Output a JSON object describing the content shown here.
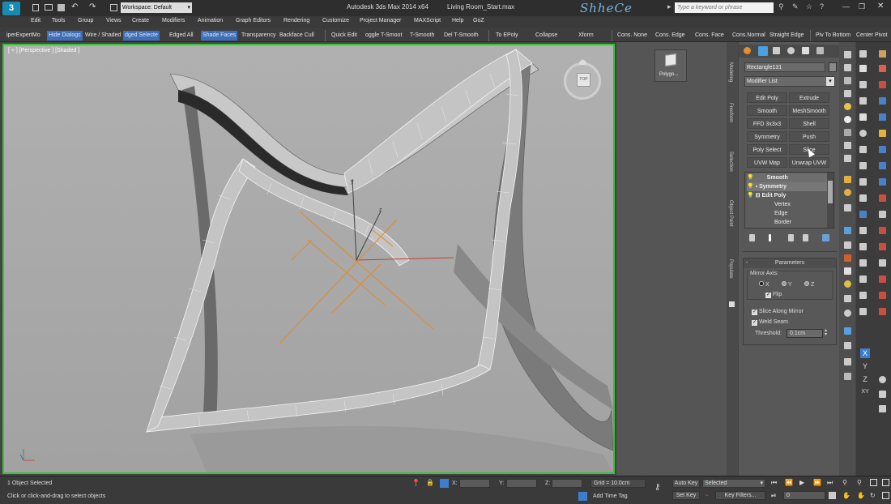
{
  "title": {
    "workspace": "Workspace: Default",
    "app": "Autodesk 3ds Max  2014 x64",
    "file": "Living Room_Start.max",
    "watermark": "ShheCe",
    "search_placeholder": "Type a keyword or phrase"
  },
  "menu": [
    "Edit",
    "Tools",
    "Group",
    "Views",
    "Create",
    "Modifiers",
    "Animation",
    "Graph Editors",
    "Rendering",
    "Customize",
    "Project Manager",
    "MAXScript",
    "Help",
    "GoZ"
  ],
  "toolbar": [
    "iperExpertMo",
    "Hide Dialogs",
    "Wire / Shaded",
    "dged Selecte",
    "Edged All",
    "Shade Faces",
    "Transparency",
    "Backface Cull",
    "Quick Edit",
    "oggle T-Smoot",
    "T-Smooth",
    "Del T-Smooth",
    "To  EPoly",
    "Collapse",
    "Xform",
    "Cons. None",
    "Cons. Edge",
    "Cons. Face",
    "Cons.Normal",
    "Straight Edge",
    "Piv To Bottom",
    "Center Pivot"
  ],
  "viewport": {
    "label": "[ + ] [Perspective ] [Shaded ]",
    "viewcube_label": "TOP"
  },
  "midpanel": {
    "polygon_label": "Polygo..."
  },
  "side_tabs": [
    "Modeling",
    "Freeform",
    "Selection",
    "Object Paint",
    "Populate"
  ],
  "cmd": {
    "object_name": "Rectangle131",
    "modifier_list": "Modifier List",
    "buttons": [
      "Edit Poly",
      "Extrude",
      "Smooth",
      "MeshSmooth",
      "FFD 3x3x3",
      "Shell",
      "Symmetry",
      "Push",
      "Poly Select",
      "Slice",
      "UVW Map",
      "Unwrap UVW"
    ],
    "stack": [
      "Smooth",
      "Symmetry",
      "Edit Poly",
      "Vertex",
      "Edge",
      "Border"
    ],
    "rollout": "Parameters",
    "mirror_axis": "Mirror Axis:",
    "axes": [
      "X",
      "Y",
      "Z"
    ],
    "flip": "Flip",
    "slice": "Slice Along Mirror",
    "weld": "Weld Seam",
    "threshold_label": "Threshold:",
    "threshold_value": "0.1cm"
  },
  "status": {
    "selected": "1 Object Selected",
    "prompt": "Click or click-and-drag to select objects",
    "x": "X:",
    "y": "Y:",
    "z": "Z:",
    "grid": "Grid = 10.0cm",
    "add_time_tag": "Add Time Tag",
    "auto_key": "Auto Key",
    "set_key": "Set Key",
    "selected_dd": "Selected",
    "key_filters": "Key Filters...",
    "frame": "0"
  },
  "axis_letters": [
    "X",
    "Y",
    "Z",
    "XY"
  ],
  "colors": {
    "viewport_border": "#34c434",
    "highlight": "#3b6fbe",
    "gizmo": "#e08a2a"
  }
}
